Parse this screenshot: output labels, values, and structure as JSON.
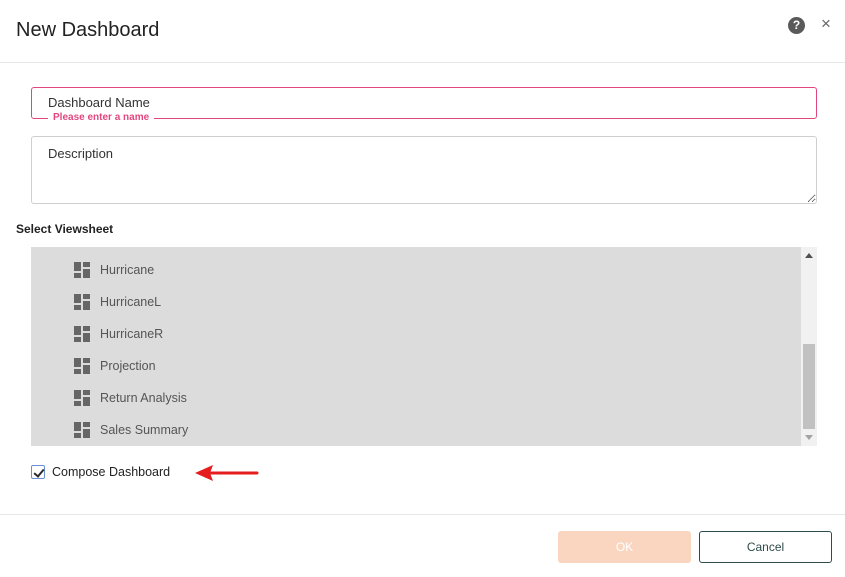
{
  "dialog": {
    "title": "New Dashboard",
    "help_icon": "question-circle-icon",
    "close_icon": "close-icon",
    "close_glyph": "×",
    "help_glyph": "?"
  },
  "form": {
    "name_placeholder": "Dashboard Name",
    "name_value": "",
    "name_error": "Please enter a name",
    "description_placeholder": "Description",
    "description_value": ""
  },
  "viewsheet": {
    "label": "Select Viewsheet",
    "item_icon": "viewsheet-icon",
    "items": [
      {
        "label": "Hurricane"
      },
      {
        "label": "HurricaneL"
      },
      {
        "label": "HurricaneR"
      },
      {
        "label": "Projection"
      },
      {
        "label": "Return Analysis"
      },
      {
        "label": "Sales Summary"
      }
    ]
  },
  "compose": {
    "label": "Compose Dashboard",
    "checked": true
  },
  "annotation": {
    "arrow_icon": "red-arrow-icon",
    "color": "#e41e1e"
  },
  "footer": {
    "ok_label": "OK",
    "cancel_label": "Cancel"
  },
  "colors": {
    "error": "#e3467f",
    "ok_disabled": "#fad6c1",
    "cancel_border": "#2f4b4b",
    "list_background": "#dcdcdc"
  }
}
